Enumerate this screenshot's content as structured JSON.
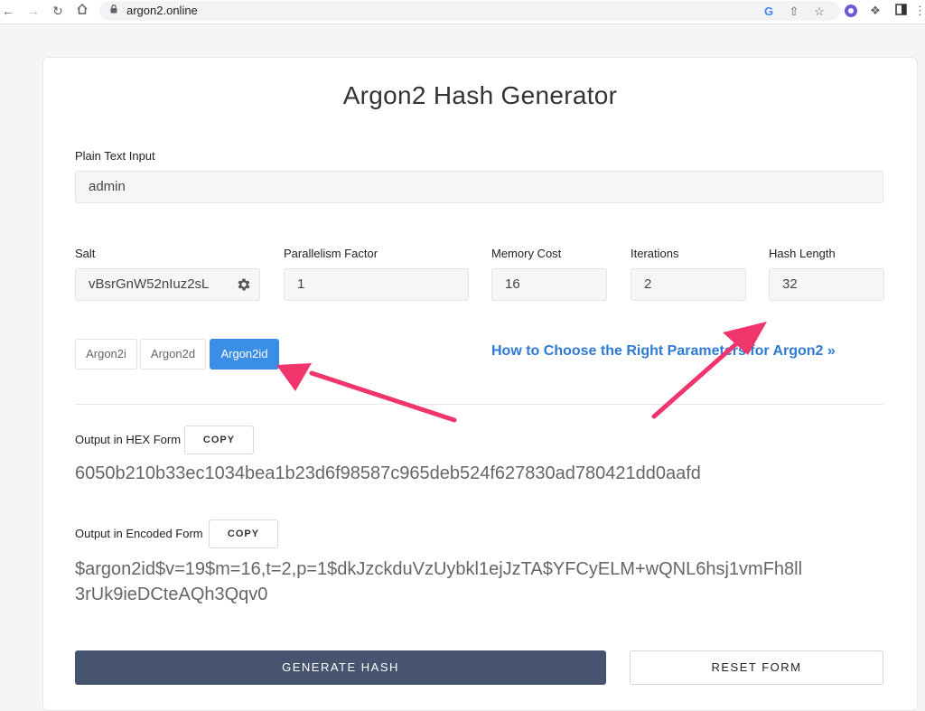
{
  "browser": {
    "url": "argon2.online"
  },
  "page": {
    "title": "Argon2 Hash Generator"
  },
  "form": {
    "plain_text": {
      "label": "Plain Text Input",
      "value": "admin"
    },
    "salt": {
      "label": "Salt",
      "value": "vBsrGnW52nIuz2sL"
    },
    "parallelism": {
      "label": "Parallelism Factor",
      "value": "1"
    },
    "memory": {
      "label": "Memory Cost",
      "value": "16"
    },
    "iterations": {
      "label": "Iterations",
      "value": "2"
    },
    "hash_length": {
      "label": "Hash Length",
      "value": "32"
    }
  },
  "algorithms": {
    "items": [
      "Argon2i",
      "Argon2d",
      "Argon2id"
    ],
    "selected": "Argon2id"
  },
  "help_link": "How to Choose the Right Parameters for Argon2 »",
  "output": {
    "hex_label": "Output in HEX Form",
    "hex_value": "6050b210b33ec1034bea1b23d6f98587c965deb524f627830ad780421dd0aafd",
    "encoded_label": "Output in Encoded Form",
    "encoded_line1": "$argon2id$v=19$m=16,t=2,p=1$dkJzckduVzUybkl1ejJzTA$YFCyELM+wQNL6hsj1vmFh8ll",
    "encoded_line2": "3rUk9ieDCteAQh3Qqv0",
    "copy_label": "COPY"
  },
  "actions": {
    "generate": "GENERATE HASH",
    "reset": "RESET FORM"
  },
  "colors": {
    "accent": "#3b8ee5",
    "generate_button": "#465470",
    "annotation_arrow": "#f0346c",
    "link": "#2f7bd3"
  }
}
